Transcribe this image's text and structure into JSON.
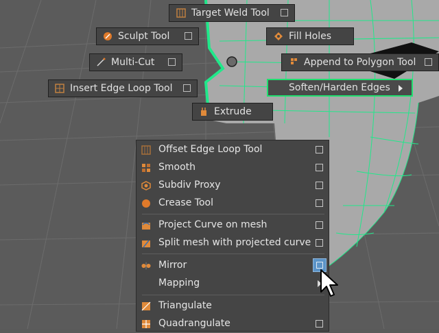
{
  "hotbox": {
    "target_weld": "Target Weld Tool",
    "sculpt": "Sculpt Tool",
    "fill_holes": "Fill Holes",
    "multi_cut": "Multi-Cut",
    "append_polygon": "Append to Polygon Tool",
    "insert_edge_loop": "Insert Edge Loop Tool",
    "soften_harden": "Soften/Harden Edges",
    "extrude": "Extrude"
  },
  "menu": {
    "items": [
      {
        "label": "Offset Edge Loop Tool",
        "icon": "offset-edge-loop-icon",
        "has_option_box": true
      },
      {
        "label": "Smooth",
        "icon": "smooth-icon",
        "has_option_box": true
      },
      {
        "label": "Subdiv Proxy",
        "icon": "subdiv-proxy-icon",
        "has_option_box": true
      },
      {
        "label": "Crease Tool",
        "icon": "crease-tool-icon",
        "has_option_box": true
      },
      {
        "label": "Project Curve on mesh",
        "icon": "project-curve-icon",
        "has_option_box": true
      },
      {
        "label": "Split mesh with projected curve",
        "icon": "split-mesh-icon",
        "has_option_box": true
      },
      {
        "label": "Mirror",
        "icon": "mirror-icon",
        "has_option_box": true,
        "highlighted": true
      },
      {
        "label": "Mapping",
        "icon": "",
        "has_submenu": true
      },
      {
        "label": "Triangulate",
        "icon": "triangulate-icon",
        "has_option_box": false
      },
      {
        "label": "Quadrangulate",
        "icon": "quadrangulate-icon",
        "has_option_box": true
      }
    ]
  },
  "colors": {
    "selection_wire": "#20e88a",
    "highlight": "#5b93c7",
    "menu_bg": "#454545",
    "mesh_surface": "#a8a8a8"
  }
}
